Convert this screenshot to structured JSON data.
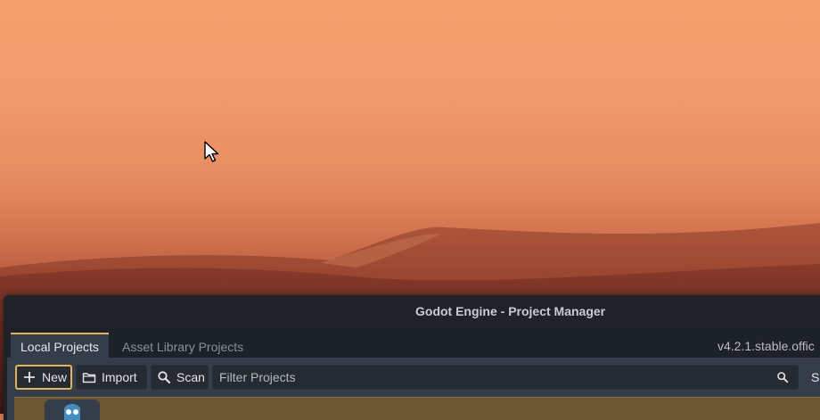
{
  "window": {
    "title": "Godot Engine - Project Manager"
  },
  "tabs": [
    {
      "label": "Local Projects",
      "active": true
    },
    {
      "label": "Asset Library Projects",
      "active": false
    }
  ],
  "version": "v4.2.1.stable.offic",
  "toolbar": {
    "new_label": "New",
    "import_label": "Import",
    "scan_label": "Scan",
    "filter_placeholder": "Filter Projects",
    "sort_label": "So"
  },
  "colors": {
    "accent": "#e3b35a",
    "panel": "#363d4a",
    "titlebar": "#1f2329",
    "selected_row": "#6a5630"
  },
  "icons": {
    "new": "plus-icon",
    "import": "folder-icon",
    "scan": "search-icon",
    "filter": "search-icon",
    "cursor": "mouse-pointer-icon"
  }
}
